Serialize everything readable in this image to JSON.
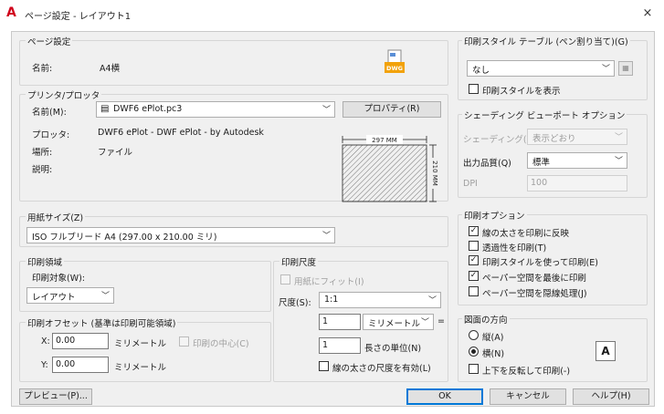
{
  "window": {
    "app_icon": "autocad-logo-icon",
    "logo_letter": "A",
    "title": "ページ設定 - レイアウト1",
    "close_glyph": "×"
  },
  "page_setup": {
    "group_label": "ページ設定",
    "name_label": "名前:",
    "name_value": "A4横",
    "dwg_badge": "DWG"
  },
  "plotter": {
    "group_label": "プリンタ/プロッタ",
    "name_label": "名前(M):",
    "device_value": "DWF6 ePlot.pc3",
    "properties_button": "プロパティ(R)",
    "plotter_label": "プロッタ:",
    "plotter_value": "DWF6 ePlot - DWF ePlot - by Autodesk",
    "where_label": "場所:",
    "where_value": "ファイル",
    "description_label": "説明:",
    "preview_width": "297 MM",
    "preview_height": "210 MM"
  },
  "paper_size": {
    "group_label": "用紙サイズ(Z)",
    "value": "ISO フルブリード A4 (297.00 x 210.00 ミリ)"
  },
  "plot_area": {
    "group_label": "印刷領域",
    "what_label": "印刷対象(W):",
    "what_value": "レイアウト"
  },
  "plot_offset": {
    "group_label": "印刷オフセット (基準は印刷可能領域)",
    "x_label": "X:",
    "x_value": "0.00",
    "x_unit": "ミリメートル",
    "center_label": "印刷の中心(C)",
    "y_label": "Y:",
    "y_value": "0.00",
    "y_unit": "ミリメートル"
  },
  "plot_scale": {
    "group_label": "印刷尺度",
    "fit_label": "用紙にフィット(I)",
    "scale_label": "尺度(S):",
    "scale_value": "1:1",
    "mm_value": "1",
    "mm_unit": "ミリメートル",
    "equals": "=",
    "unit_value": "1",
    "unit_label": "長さの単位(N)",
    "lineweights_label": "線の太さの尺度を有効(L)"
  },
  "plot_style_table": {
    "group_label": "印刷スタイル テーブル (ペン割り当て)(G)",
    "value": "なし",
    "edit_icon": "edit-table-icon",
    "display_label": "印刷スタイルを表示"
  },
  "shaded_viewport": {
    "group_label": "シェーディング ビューポート オプション",
    "shade_label": "シェーディング(D)",
    "shade_value": "表示どおり",
    "quality_label": "出力品質(Q)",
    "quality_value": "標準",
    "dpi_label": "DPI",
    "dpi_value": "100"
  },
  "plot_options": {
    "group_label": "印刷オプション",
    "items": [
      {
        "label": "線の太さを印刷に反映",
        "checked": true
      },
      {
        "label": "透過性を印刷(T)",
        "checked": false
      },
      {
        "label": "印刷スタイルを使って印刷(E)",
        "checked": true
      },
      {
        "label": "ペーパー空間を最後に印刷",
        "checked": true
      },
      {
        "label": "ペーパー空間を隠線処理(J)",
        "checked": false
      }
    ]
  },
  "orientation": {
    "group_label": "図面の方向",
    "portrait_label": "縦(A)",
    "landscape_label": "横(N)",
    "selected": "landscape",
    "upside_down_label": "上下を反転して印刷(-)",
    "icon_letter": "A"
  },
  "footer": {
    "preview_button": "プレビュー(P)...",
    "ok_button": "OK",
    "cancel_button": "キャンセル",
    "help_button": "ヘルプ(H)"
  }
}
